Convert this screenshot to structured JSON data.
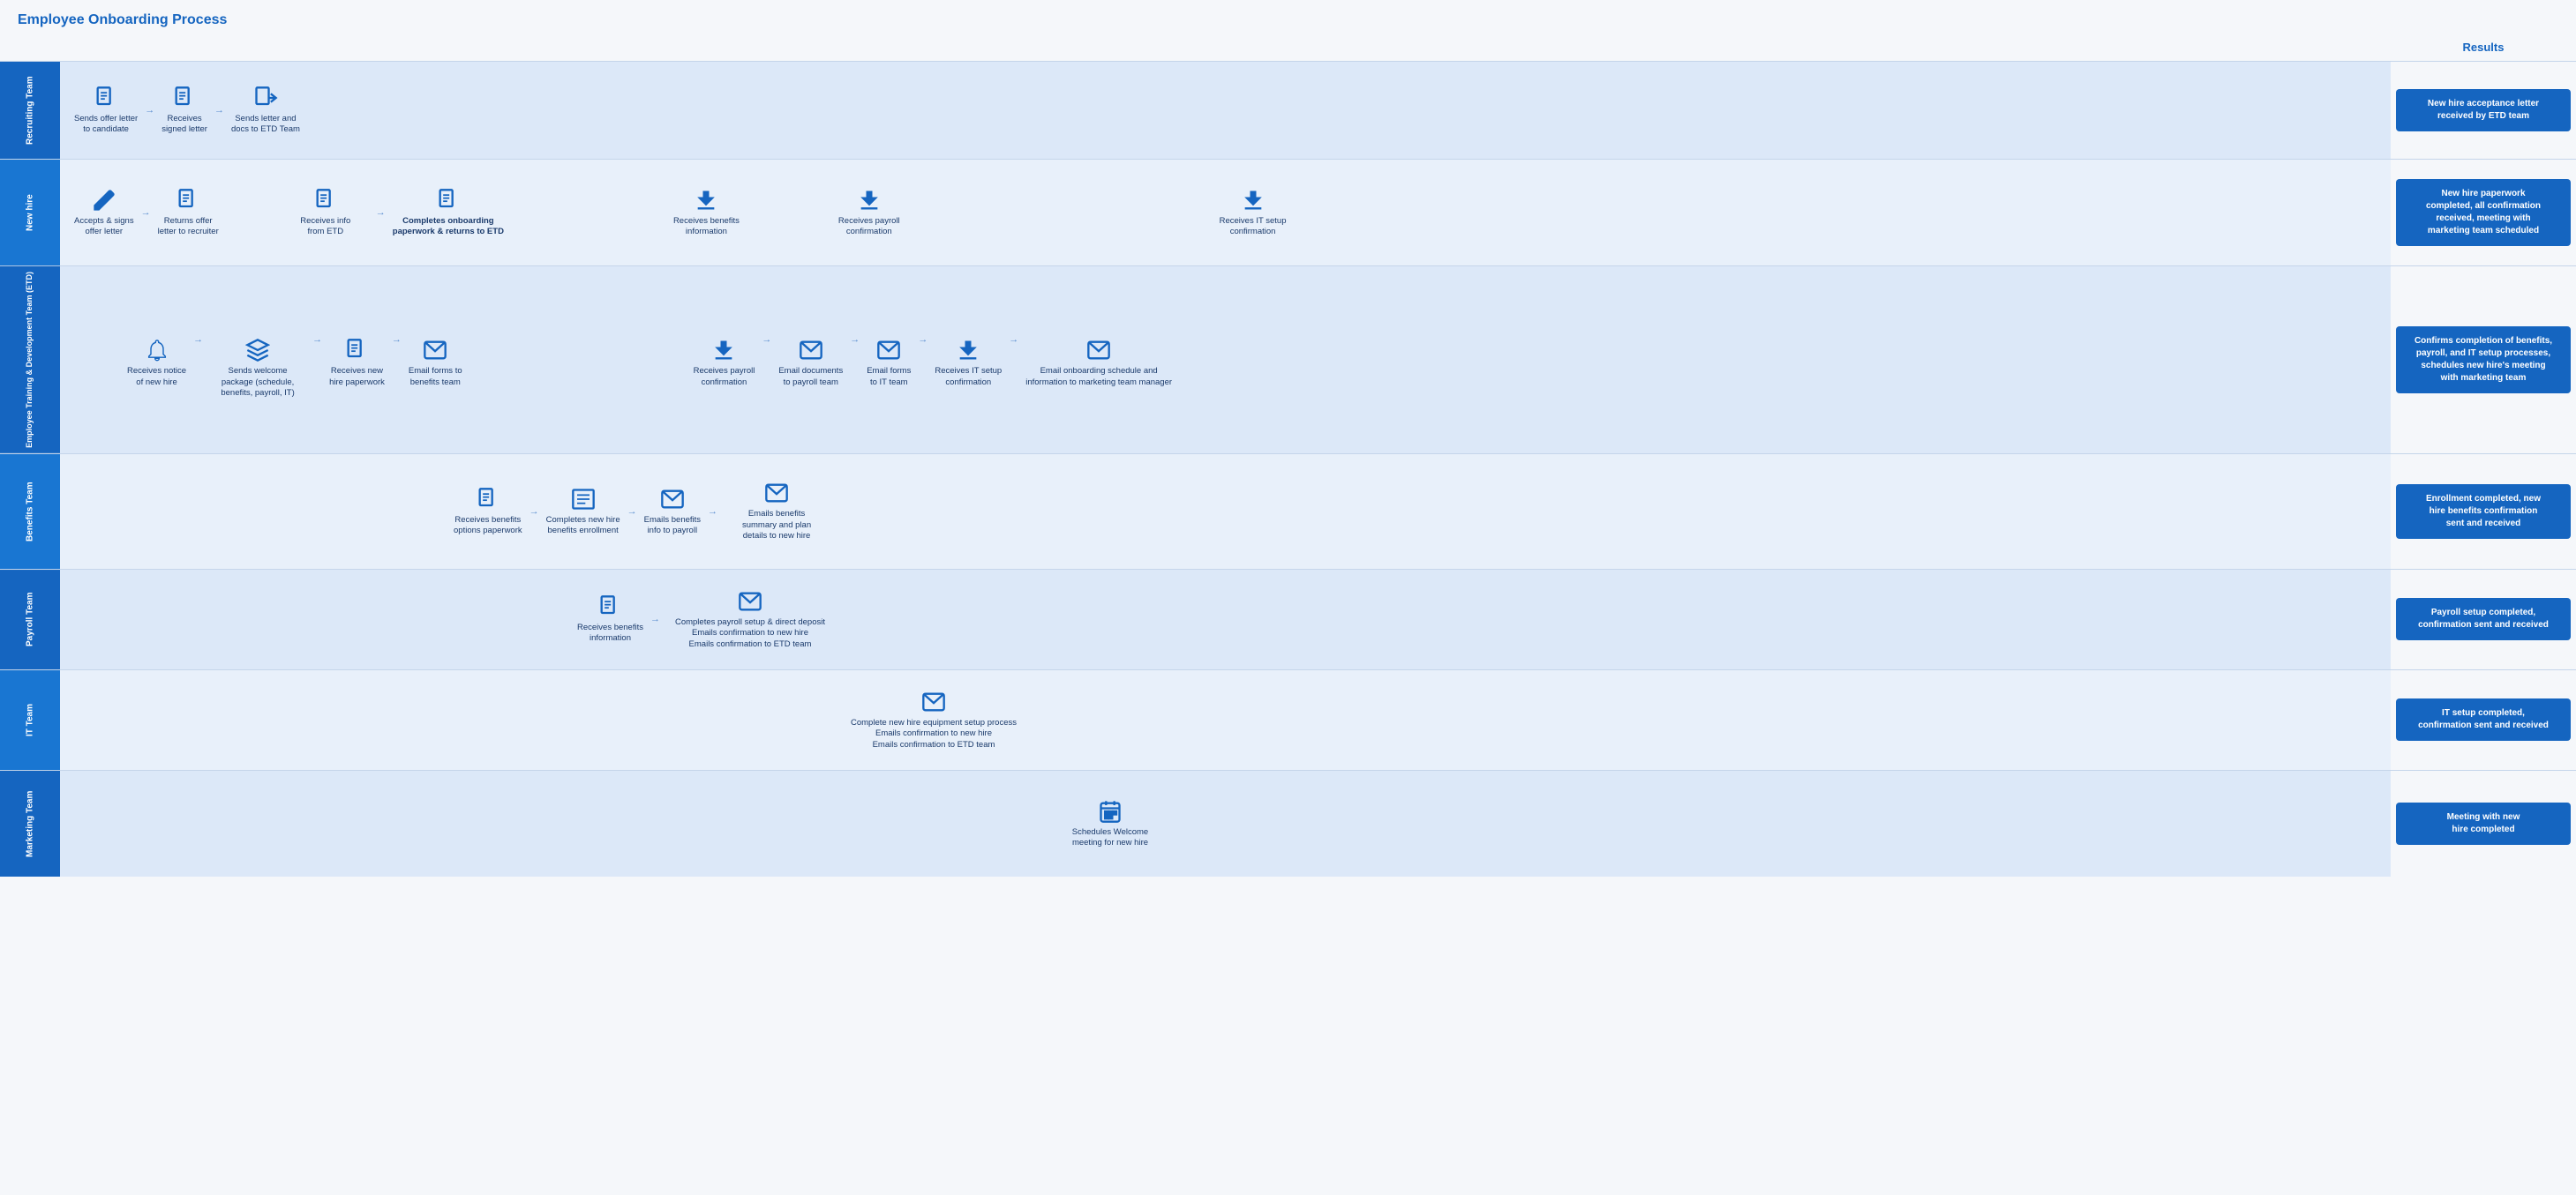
{
  "title": "Employee Onboarding Process",
  "results_header": "Results",
  "lanes": [
    {
      "id": "recruiting",
      "label": "Recruiting Team",
      "alt": false,
      "nodes": [
        {
          "icon": "doc",
          "label": "Sends offer letter to candidate"
        },
        {
          "arrow": "right"
        },
        {
          "icon": "doc",
          "label": "Receives signed letter"
        },
        {
          "arrow": "right"
        },
        {
          "icon": "doc-arrow",
          "label": "Sends letter and docs to ETD Team"
        }
      ],
      "result": "New hire acceptance letter received by ETD team"
    },
    {
      "id": "newhire",
      "label": "New hire",
      "alt": true,
      "nodes": [
        {
          "icon": "pencil",
          "label": "Accepts & signs offer letter"
        },
        {
          "arrow": "right"
        },
        {
          "icon": "doc",
          "label": "Returns offer letter to recruiter"
        },
        {
          "spacer": true
        },
        {
          "icon": "doc",
          "label": "Receives info from ETD"
        },
        {
          "arrow": "right"
        },
        {
          "icon": "doc-bold",
          "label": "Completes onboarding paperwork & returns to ETD",
          "bold": true
        },
        {
          "spacer": true
        },
        {
          "icon": "download",
          "label": "Receives benefits information"
        },
        {
          "spacer": true
        },
        {
          "icon": "download",
          "label": "Receives payroll confirmation"
        },
        {
          "spacer": true
        },
        {
          "icon": "download",
          "label": "Receives IT setup confirmation"
        }
      ],
      "result": "New hire paperwork completed, all confirmation received, meeting with marketing team scheduled"
    },
    {
      "id": "etd",
      "label": "Employee Training & Development Team (ETD)",
      "alt": false,
      "nodes": [
        {
          "spacer": true
        },
        {
          "icon": "bell",
          "label": "Receives notice of new hire"
        },
        {
          "arrow": "right"
        },
        {
          "icon": "cube",
          "label": "Sends welcome package (schedule, benefits, payroll, IT)"
        },
        {
          "arrow": "right"
        },
        {
          "icon": "doc",
          "label": "Receives new hire paperwork"
        },
        {
          "arrow": "right"
        },
        {
          "icon": "email",
          "label": "Email forms to benefits team"
        },
        {
          "spacer": true
        },
        {
          "icon": "download",
          "label": "Receives payroll confirmation"
        },
        {
          "arrow": "right"
        },
        {
          "icon": "email",
          "label": "Email documents to payroll team"
        },
        {
          "arrow": "right"
        },
        {
          "icon": "email",
          "label": "Email forms to IT team"
        },
        {
          "arrow": "right"
        },
        {
          "icon": "download",
          "label": "Receives IT setup confirmation"
        },
        {
          "arrow": "right"
        },
        {
          "icon": "email",
          "label": "Email onboarding schedule and information to marketing team manager"
        }
      ],
      "result": "Confirms completion of benefits, payroll, and IT setup processes, schedules new hire's meeting with marketing team"
    },
    {
      "id": "benefits",
      "label": "Benefits Team",
      "alt": true,
      "nodes": [
        {
          "spacer": true
        },
        {
          "icon": "doc",
          "label": "Receives benefits options paperwork"
        },
        {
          "arrow": "right"
        },
        {
          "icon": "list",
          "label": "Completes new hire benefits enrollment"
        },
        {
          "arrow": "right"
        },
        {
          "icon": "email",
          "label": "Emails benefits info to payroll"
        },
        {
          "arrow": "right"
        },
        {
          "icon": "email",
          "label": "Emails benefits summary and plan details to new hire"
        }
      ],
      "result": "Enrollment completed, new hire benefits confirmation sent and received"
    },
    {
      "id": "payroll",
      "label": "Payroll Team",
      "alt": false,
      "nodes": [
        {
          "spacer": true
        },
        {
          "icon": "doc",
          "label": "Receives benefits information"
        },
        {
          "arrow": "right"
        },
        {
          "icon": "email",
          "label": "Completes payroll setup & direct deposit\nEmails confirmation to new hire\nEmails confirmation to ETD team"
        }
      ],
      "result": "Payroll setup completed, confirmation sent and received"
    },
    {
      "id": "it",
      "label": "IT Team",
      "alt": true,
      "nodes": [
        {
          "spacer": true
        },
        {
          "icon": "email",
          "label": "Complete new hire equipment setup process\nEmails confirmation to new hire\nEmails confirmation to ETD team"
        }
      ],
      "result": "IT setup completed, confirmation sent and received"
    },
    {
      "id": "marketing",
      "label": "Marketing Team",
      "alt": false,
      "nodes": [
        {
          "spacer": true
        },
        {
          "icon": "calendar",
          "label": "Schedules Welcome meeting for new hire"
        }
      ],
      "result": "Meeting with new hire completed"
    }
  ]
}
